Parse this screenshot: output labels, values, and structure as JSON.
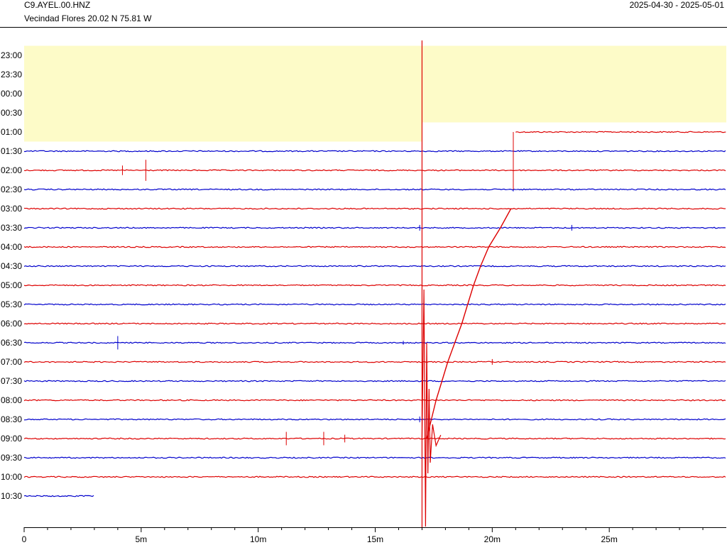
{
  "header": {
    "station": "C9.AYEL.00.HNZ",
    "location": "Vecindad Flores  20.02 N 75.81 W",
    "date_range": "2025-04-30 - 2025-05-01"
  },
  "chart_data": {
    "type": "line",
    "title": "C9.AYEL.00.HNZ",
    "xlabel": "",
    "ylabel": "",
    "x_unit": "minutes",
    "xlim": [
      0,
      30
    ],
    "x_ticks": [
      {
        "value": 0,
        "label": "0"
      },
      {
        "value": 5,
        "label": "5m"
      },
      {
        "value": 10,
        "label": "10m"
      },
      {
        "value": 15,
        "label": "15m"
      },
      {
        "value": 20,
        "label": "20m"
      },
      {
        "value": 25,
        "label": "25m"
      }
    ],
    "rows": [
      "23:00",
      "23:30",
      "00:00",
      "00:30",
      "01:00",
      "01:30",
      "02:00",
      "02:30",
      "03:00",
      "03:30",
      "04:00",
      "04:30",
      "05:00",
      "05:30",
      "06:00",
      "06:30",
      "07:00",
      "07:30",
      "08:00",
      "08:30",
      "09:00",
      "09:30",
      "10:00",
      "10:30"
    ],
    "row_colors": [
      "#dd0000",
      "#0000cc"
    ],
    "no_data_color": "#fdfbc8",
    "no_data": [
      {
        "row_start": "23:00",
        "row_end": "01:00",
        "minute_start": 0,
        "minute_end": 17
      },
      {
        "row_start": "23:00",
        "row_end": "00:30",
        "minute_start": 17,
        "minute_end": 30
      }
    ],
    "traces": [
      {
        "row": "01:00",
        "start_min": 21,
        "end_min": 30
      },
      {
        "row": "01:30",
        "start_min": 0,
        "end_min": 30
      },
      {
        "row": "02:00",
        "start_min": 0,
        "end_min": 30
      },
      {
        "row": "02:30",
        "start_min": 0,
        "end_min": 30
      },
      {
        "row": "03:00",
        "start_min": 0,
        "end_min": 30
      },
      {
        "row": "03:30",
        "start_min": 0,
        "end_min": 30
      },
      {
        "row": "04:00",
        "start_min": 0,
        "end_min": 30
      },
      {
        "row": "04:30",
        "start_min": 0,
        "end_min": 30
      },
      {
        "row": "05:00",
        "start_min": 0,
        "end_min": 30
      },
      {
        "row": "05:30",
        "start_min": 0,
        "end_min": 30
      },
      {
        "row": "06:00",
        "start_min": 0,
        "end_min": 30
      },
      {
        "row": "06:30",
        "start_min": 0,
        "end_min": 30
      },
      {
        "row": "07:00",
        "start_min": 0,
        "end_min": 30
      },
      {
        "row": "07:30",
        "start_min": 0,
        "end_min": 30
      },
      {
        "row": "08:00",
        "start_min": 0,
        "end_min": 30
      },
      {
        "row": "08:30",
        "start_min": 0,
        "end_min": 30
      },
      {
        "row": "09:00",
        "start_min": 0,
        "end_min": 30
      },
      {
        "row": "09:30",
        "start_min": 0,
        "end_min": 30
      },
      {
        "row": "10:00",
        "start_min": 0,
        "end_min": 30
      },
      {
        "row": "10:30",
        "start_min": 0,
        "end_min": 3
      }
    ],
    "spikes": [
      {
        "row": "02:00",
        "minute": 4.2,
        "amplitude": 0.25
      },
      {
        "row": "02:00",
        "minute": 5.2,
        "amplitude": 0.55
      },
      {
        "row": "02:30",
        "minute": 20.9,
        "amplitude": 0.1
      },
      {
        "row": "03:30",
        "minute": 16.9,
        "amplitude": 0.15
      },
      {
        "row": "03:30",
        "minute": 23.4,
        "amplitude": 0.15
      },
      {
        "row": "06:30",
        "minute": 4.0,
        "amplitude": 0.35
      },
      {
        "row": "06:30",
        "minute": 16.2,
        "amplitude": 0.1
      },
      {
        "row": "07:00",
        "minute": 20.0,
        "amplitude": 0.15
      },
      {
        "row": "08:30",
        "minute": 16.9,
        "amplitude": 0.15
      },
      {
        "row": "09:00",
        "minute": 11.2,
        "amplitude": 0.35
      },
      {
        "row": "09:00",
        "minute": 12.8,
        "amplitude": 0.35
      },
      {
        "row": "09:00",
        "minute": 13.7,
        "amplitude": 0.2
      }
    ],
    "event": {
      "minute": 17.0,
      "description_rows": [
        "09:00",
        "10:00"
      ],
      "full_height_line": true
    },
    "drift_curve": [
      {
        "row": "09:00",
        "minute": 17.2
      },
      {
        "row": "08:30",
        "minute": 17.4
      },
      {
        "row": "08:00",
        "minute": 17.6
      },
      {
        "row": "07:30",
        "minute": 17.85
      },
      {
        "row": "07:00",
        "minute": 18.1
      },
      {
        "row": "06:30",
        "minute": 18.4
      },
      {
        "row": "06:00",
        "minute": 18.7
      },
      {
        "row": "05:30",
        "minute": 18.95
      },
      {
        "row": "05:00",
        "minute": 19.2
      },
      {
        "row": "04:30",
        "minute": 19.5
      },
      {
        "row": "04:00",
        "minute": 19.85
      },
      {
        "row": "03:30",
        "minute": 20.35
      },
      {
        "row": "03:00",
        "minute": 20.8
      }
    ],
    "connector": {
      "minute": 20.9,
      "from_row": "02:30",
      "to_row": "01:00"
    },
    "grid": false,
    "legend": "none"
  }
}
